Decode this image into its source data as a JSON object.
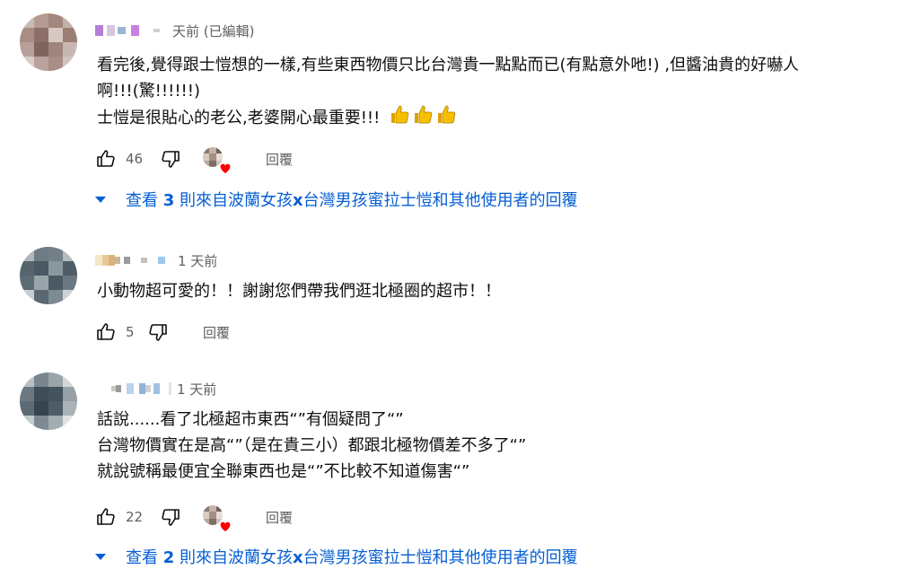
{
  "comments": [
    {
      "time": "天前 (已編輯)",
      "lines": [
        "看完後,覺得跟士愷想的一樣,有些東西物價只比台灣貴一點點而已(有點意外吔!) ,但醬油貴的好嚇人",
        "啊!!!(驚!!!!!!)",
        "士愷是很貼心的老公,老婆開心最重要!!!"
      ],
      "emoji": "thumbs-up-emoji x3",
      "likes": "46",
      "reply_label": "回覆",
      "replies": {
        "prefix": "查看 ",
        "count": "3",
        "mid": " 則來自波蘭女孩",
        "x": "x",
        "suffix": "台灣男孩蜜拉士愷和其他使用者的回覆"
      }
    },
    {
      "time": "1 天前",
      "lines": [
        "小動物超可愛的！！謝謝您們帶我們逛北極圈的超市！！"
      ],
      "likes": "5",
      "reply_label": "回覆"
    },
    {
      "time": "1 天前",
      "lines": [
        "話說......看了北極超市東西“”有個疑問了“”",
        "台灣物價實在是高“”（是在貴三小）都跟北極物價差不多了“”",
        "就說號稱最便宜全聯東西也是“”不比較不知道傷害“”"
      ],
      "likes": "22",
      "reply_label": "回覆",
      "replies": {
        "prefix": "查看 ",
        "count": "2",
        "mid": " 則來自波蘭女孩",
        "x": "x",
        "suffix": "台灣男孩蜜拉士愷和其他使用者的回覆"
      }
    }
  ],
  "colors": {
    "link": "#065fd4",
    "meta": "#606060",
    "heart": "#ff0000",
    "emoji": "#f5b000"
  },
  "icons": [
    "thumb-up-icon",
    "thumb-down-icon",
    "creator-heart-icon",
    "caret-down-icon"
  ]
}
